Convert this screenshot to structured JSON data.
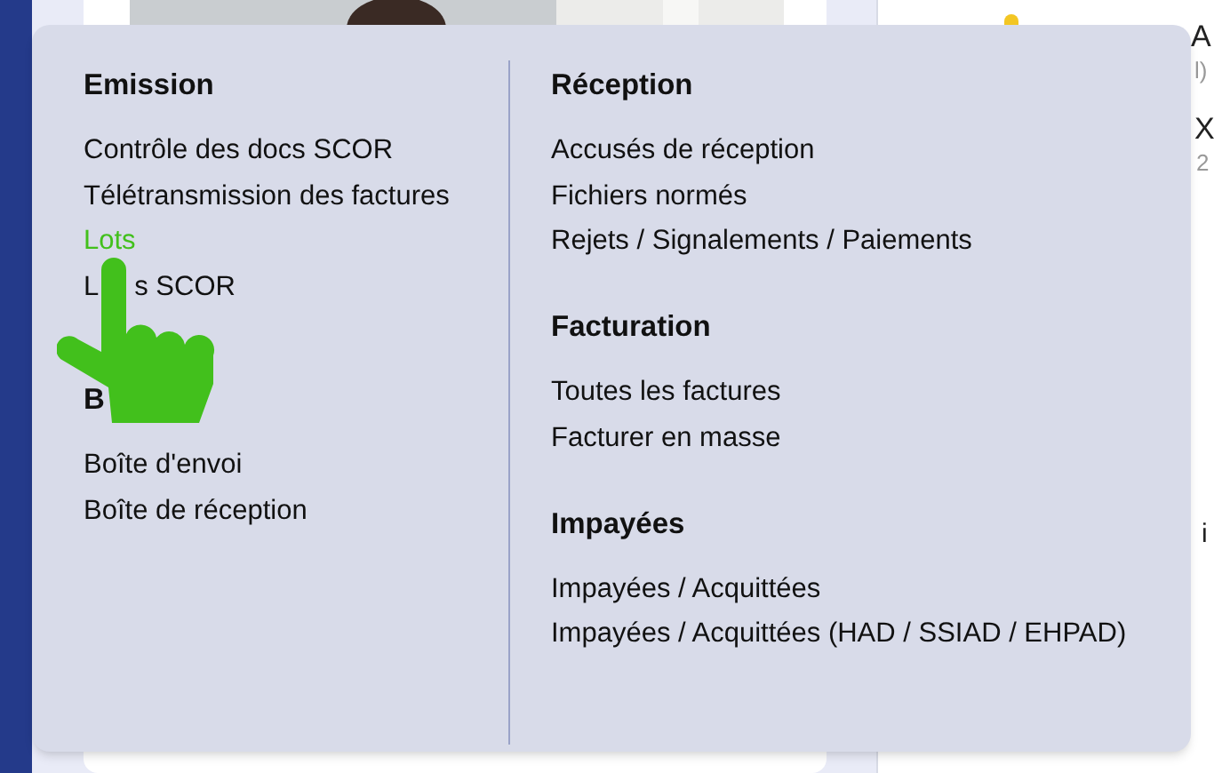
{
  "background": {
    "right_panel": {
      "rows": [
        {
          "title": "A",
          "subtitle": "l)"
        },
        {
          "title": "X",
          "subtitle": "2"
        }
      ],
      "note": "i"
    }
  },
  "menu": {
    "columns": [
      {
        "sections": [
          {
            "heading": "Emission",
            "items": [
              {
                "label": "Contrôle des docs SCOR",
                "hovered": false
              },
              {
                "label": "Télétransmission des factures",
                "hovered": false
              },
              {
                "label": "Lots",
                "hovered": true
              },
              {
                "label_parts": [
                  "L",
                  "s SCOR"
                ],
                "hovered": false
              }
            ]
          },
          {
            "heading": "B",
            "items": [
              {
                "label": "Boîte d'envoi",
                "hovered": false
              },
              {
                "label": "Boîte de réception",
                "hovered": false
              }
            ]
          }
        ]
      },
      {
        "sections": [
          {
            "heading": "Réception",
            "items": [
              {
                "label": "Accusés de réception",
                "hovered": false
              },
              {
                "label": "Fichiers normés",
                "hovered": false
              },
              {
                "label": "Rejets / Signalements / Paiements",
                "hovered": false
              }
            ]
          },
          {
            "heading": "Facturation",
            "items": [
              {
                "label": "Toutes les factures",
                "hovered": false
              },
              {
                "label": "Facturer en masse",
                "hovered": false
              }
            ]
          },
          {
            "heading": "Impayées",
            "items": [
              {
                "label": "Impayées / Acquittées",
                "hovered": false
              },
              {
                "label": "Impayées / Acquittées (HAD / SSIAD / EHPAD)",
                "hovered": false
              }
            ]
          }
        ]
      }
    ]
  }
}
